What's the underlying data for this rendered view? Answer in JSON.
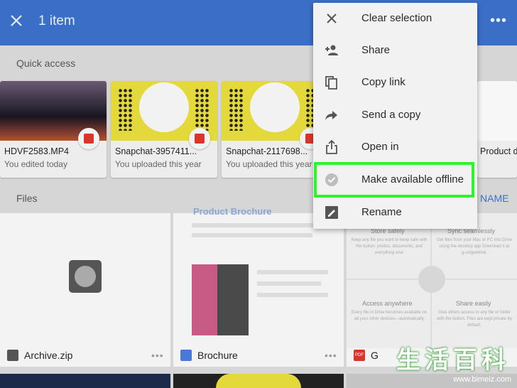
{
  "appbar": {
    "title": "1 item",
    "more": "•••",
    "color": "#3b6fc7"
  },
  "quick_access": {
    "label": "Quick access",
    "items": [
      {
        "name": "HDVF2583.MP4",
        "sub": "You edited today",
        "badge": "video-icon"
      },
      {
        "name": "Snapchat-3957411...",
        "sub": "You uploaded this year",
        "badge": "image-icon"
      },
      {
        "name": "Snapchat-2117698...",
        "sub": "You uploaded this year",
        "badge": "image-icon"
      },
      {
        "name": "Product documen",
        "sub": ""
      }
    ]
  },
  "files": {
    "label": "Files",
    "sort_label": "NAME",
    "items": [
      {
        "name": "Archive.zip",
        "icon": "zip-icon"
      },
      {
        "name": "Brochure",
        "icon": "docs-icon",
        "preview_title": "Product Brochure"
      },
      {
        "name": "G",
        "icon": "pdf-icon",
        "icon_text": "PDF"
      }
    ],
    "preview_cells": [
      {
        "title": "Store safely",
        "body": "Keep any file you want to keep safe with the button: photos, documents, and everything else"
      },
      {
        "title": "Sync seamlessly",
        "body": "Get files from your Mac or PC into Drive using the desktop app Download it at g.co/getdrive."
      },
      {
        "title": "Access anywhere",
        "body": "Every file in Drive becomes available on all your other devices—automatically"
      },
      {
        "title": "Share easily",
        "body": "Give others access to any file or folder with the button. Files are kept private by default."
      }
    ]
  },
  "menu": {
    "items": [
      {
        "label": "Clear selection",
        "icon": "close-icon"
      },
      {
        "label": "Share",
        "icon": "add-person-icon"
      },
      {
        "label": "Copy link",
        "icon": "copy-link-icon"
      },
      {
        "label": "Send a copy",
        "icon": "send-arrow-icon"
      },
      {
        "label": "Open in",
        "icon": "open-in-icon"
      },
      {
        "label": "Make available offline",
        "icon": "offline-check-icon"
      },
      {
        "label": "Rename",
        "icon": "rename-icon"
      }
    ],
    "highlight_color": "#2cf52c"
  },
  "watermark": {
    "chars": "生活百科",
    "url": "www.bimeiz.com"
  }
}
